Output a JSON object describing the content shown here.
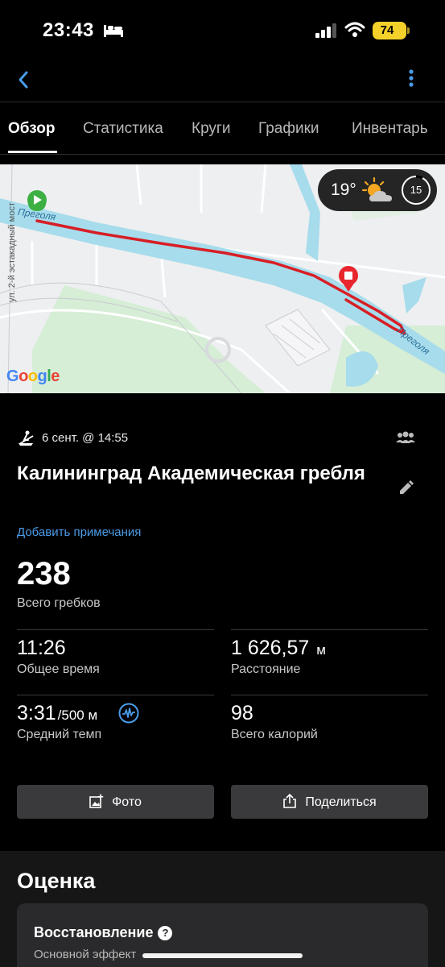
{
  "status": {
    "time": "23:43",
    "battery": "74",
    "icons": [
      "bed-icon",
      "signal-icon",
      "wifi-icon",
      "battery-charging-icon"
    ]
  },
  "nav": {
    "icons": [
      "back-chevron-icon",
      "more-vertical-icon"
    ]
  },
  "tabs": [
    {
      "label": "Обзор",
      "active": true
    },
    {
      "label": "Статистика"
    },
    {
      "label": "Круги"
    },
    {
      "label": "Графики"
    },
    {
      "label": "Инвентарь"
    }
  ],
  "map": {
    "river_label_1": "Преголя",
    "river_label_2": "Преголя",
    "street_label": "ул. 2-й эстакадный мост",
    "attribution": "Google",
    "weather": {
      "temperature": "19°",
      "icon": "partly-cloudy-sun-icon",
      "timer_value": "15"
    },
    "route_color": "#d81e25",
    "start_marker_color": "#3cb043",
    "end_marker_color": "#e8262d"
  },
  "activity": {
    "date": "6 сент. @ 14:55",
    "title": "Калининград Академическая гребля",
    "add_note": "Добавить примечания",
    "main_stat": {
      "value": "238",
      "label": "Всего гребков"
    },
    "stats": [
      {
        "value": "11:26",
        "unit": "",
        "label": "Общее время"
      },
      {
        "value": "1 626,57",
        "unit": "м",
        "label": "Расстояние"
      },
      {
        "value": "3:31",
        "unit": "/500 м",
        "label": "Средний темп"
      },
      {
        "value": "98",
        "unit": "",
        "label": "Всего калорий"
      }
    ]
  },
  "actions": {
    "photo": "Фото",
    "share": "Поделиться"
  },
  "rating": {
    "section_title": "Оценка",
    "card_title": "Восстановление",
    "card_sub": "Основной эффект"
  },
  "colors": {
    "accent_blue": "#4a9ce8",
    "background": "#000000",
    "button": "#3a3a3c"
  }
}
